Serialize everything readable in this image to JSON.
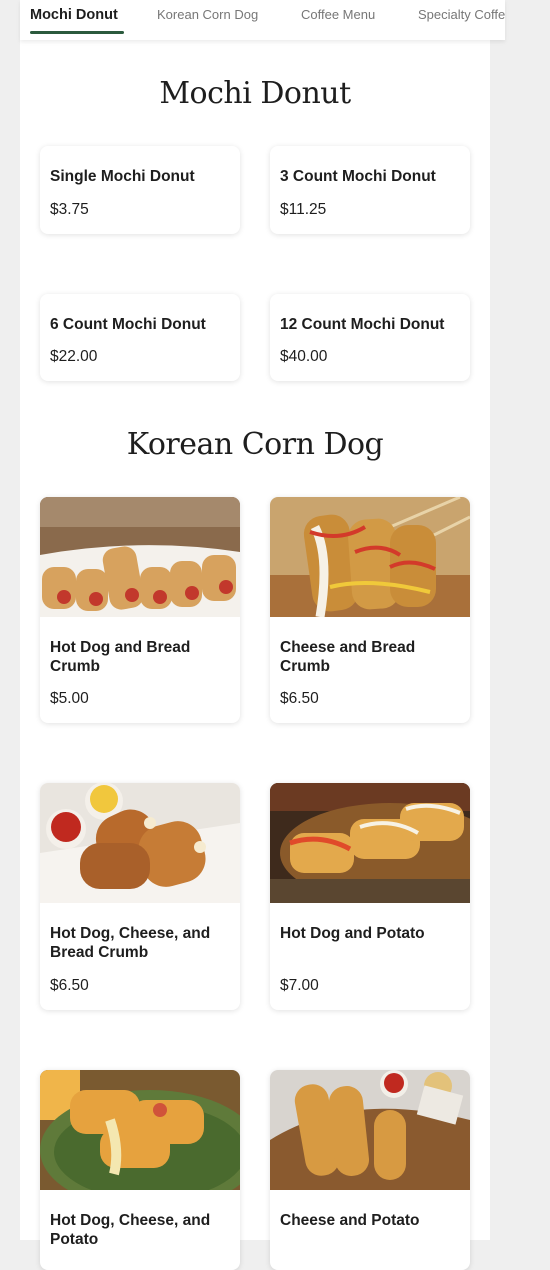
{
  "nav": {
    "tabs": [
      {
        "label": "Mochi Donut"
      },
      {
        "label": "Korean Corn Dog"
      },
      {
        "label": "Coffee Menu"
      },
      {
        "label": "Specialty Coffee"
      }
    ]
  },
  "sections": [
    {
      "title": "Mochi Donut",
      "items": [
        {
          "name": "Single Mochi Donut",
          "price": "$3.75"
        },
        {
          "name": "3 Count Mochi Donut",
          "price": "$11.25"
        },
        {
          "name": "6 Count Mochi Donut",
          "price": "$22.00"
        },
        {
          "name": "12 Count Mochi Donut",
          "price": "$40.00"
        }
      ]
    },
    {
      "title": "Korean Corn Dog",
      "items": [
        {
          "name": "Hot Dog and Bread Crumb",
          "price": "$5.00"
        },
        {
          "name": "Cheese and Bread Crumb",
          "price": "$6.50"
        },
        {
          "name": "Hot Dog, Cheese, and Bread Crumb",
          "price": "$6.50"
        },
        {
          "name": "Hot Dog and Potato",
          "price": "$7.00"
        },
        {
          "name": "Hot Dog, Cheese, and Potato",
          "price": ""
        },
        {
          "name": "Cheese and Potato",
          "price": ""
        }
      ]
    }
  ],
  "colors": {
    "accent": "#2b5a3d",
    "page_bg": "#efefef",
    "card_bg": "#ffffff"
  }
}
